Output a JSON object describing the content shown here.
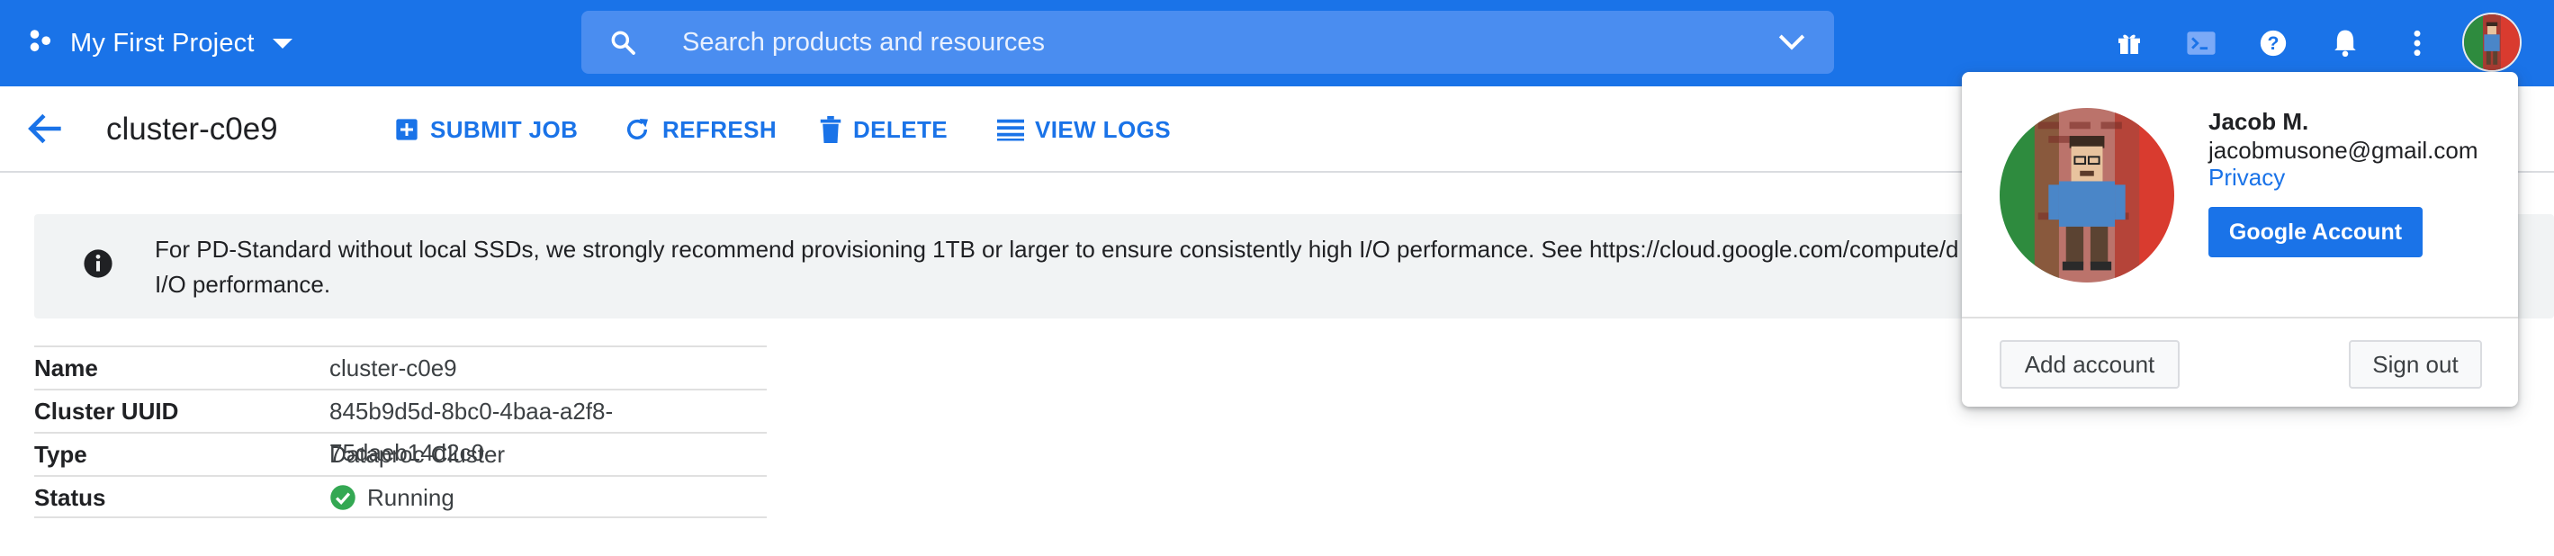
{
  "header": {
    "project_name": "My First Project",
    "search_placeholder": "Search products and resources",
    "icons": [
      "gift-icon",
      "cloud-shell-icon",
      "help-icon",
      "notifications-icon",
      "more-vert-icon"
    ]
  },
  "toolbar": {
    "title": "cluster-c0e9",
    "submit_job": "SUBMIT JOB",
    "refresh": "REFRESH",
    "delete": "DELETE",
    "view_logs": "VIEW LOGS"
  },
  "banner": {
    "message": "For PD-Standard without local SSDs, we strongly recommend provisioning 1TB or larger to ensure consistently high I/O performance. See https://cloud.google.com/compute/d",
    "message_line2": "I/O performance."
  },
  "details": {
    "rows": [
      {
        "label": "Name",
        "value": "cluster-c0e9"
      },
      {
        "label": "Cluster UUID",
        "value": "845b9d5d-8bc0-4baa-a2f8-75daeb14d2c0"
      },
      {
        "label": "Type",
        "value": "Dataproc Cluster"
      },
      {
        "label": "Status",
        "value": "Running"
      }
    ]
  },
  "account": {
    "name": "Jacob M.",
    "email": "jacobmusone@gmail.com",
    "privacy": "Privacy",
    "google_account": "Google Account",
    "add_account": "Add account",
    "sign_out": "Sign out"
  },
  "colors": {
    "brand": "#1a73e8",
    "status_ok": "#34a853"
  }
}
